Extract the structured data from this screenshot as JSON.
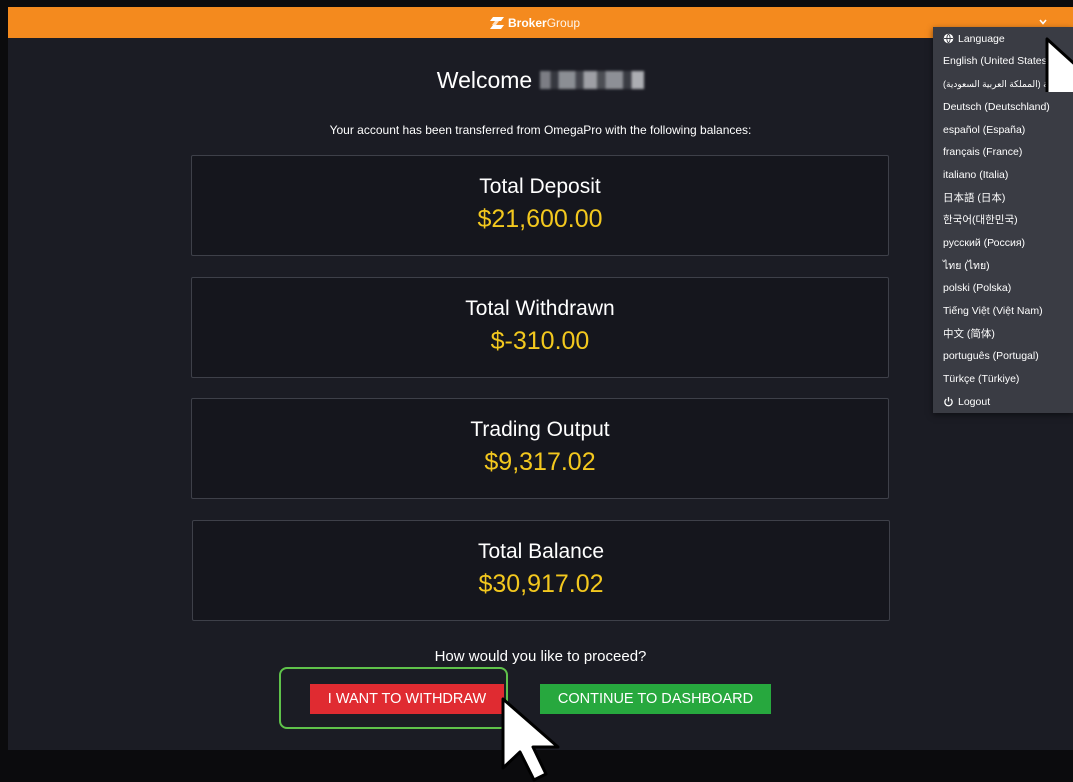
{
  "header": {
    "brand_bold": "Broker",
    "brand_light": "Group"
  },
  "welcome": {
    "greeting": "Welcome"
  },
  "transfer_message": "Your account has been transferred from OmegaPro with the following balances:",
  "balances": [
    {
      "label": "Total Deposit",
      "value": "$21,600.00"
    },
    {
      "label": "Total Withdrawn",
      "value": "$-310.00"
    },
    {
      "label": "Trading Output",
      "value": "$9,317.02"
    },
    {
      "label": "Total Balance",
      "value": "$30,917.02"
    }
  ],
  "proceed_question": "How would you like to proceed?",
  "actions": {
    "withdraw_label": "I WANT TO WITHDRAW",
    "dashboard_label": "CONTINUE TO DASHBOARD"
  },
  "language_menu": {
    "header": "Language",
    "header_icon": "globe-icon",
    "languages": [
      "English (United States)",
      "العربية (المملكة العربية السعودية)",
      "Deutsch (Deutschland)",
      "español (España)",
      "français (France)",
      "italiano (Italia)",
      "日本語 (日本)",
      "한국어(대한민국)",
      "русский (Россия)",
      "ไทย (ไทย)",
      "polski (Polska)",
      "Tiếng Việt (Việt Nam)",
      "中文 (简体)",
      "português (Portugal)",
      "Türkçe (Türkiye)"
    ],
    "logout": "Logout",
    "logout_icon": "power-icon"
  },
  "colors": {
    "topbar": "#f48a1e",
    "background": "#1b1c24",
    "amount": "#f3c81e",
    "withdraw_button": "#e02b31",
    "dashboard_button": "#27a83e",
    "highlight": "#5fc24a",
    "menu": "#3a3c44"
  }
}
